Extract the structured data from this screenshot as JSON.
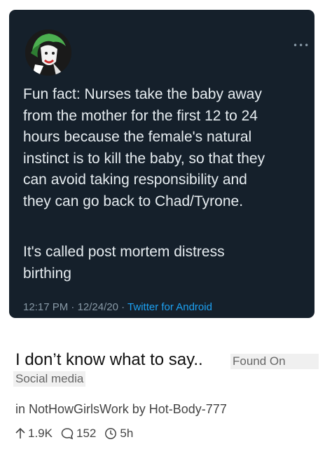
{
  "tweet": {
    "text_part1": "Fun fact: Nurses take the baby away\nfrom the mother for the first 12 to 24\nhours because the female's natural\ninstinct is to kill the baby, so that they\ncan avoid taking responsibility and\nthey can go back to Chad/Tyrone.",
    "text_part2": "It's called post mortem distress\nbirthing",
    "time": "12:17 PM",
    "date": "12/24/20",
    "separator": "·",
    "source": "Twitter for Android",
    "more_icon": "more-dots-icon",
    "avatar_icon": "joker-avatar"
  },
  "post": {
    "title": "I don’t know what to say..",
    "flair_part1": "Found On",
    "flair_part2": "Social media",
    "in_label": "in",
    "subreddit": "NotHowGirlsWork",
    "by_label": "by",
    "author": "Hot-Body-777",
    "upvotes": "1.9K",
    "comments": "152",
    "age": "5h"
  },
  "colors": {
    "card_bg": "#15202b",
    "tweet_text": "#e6ecf0",
    "meta_gray": "#8899a6",
    "link_blue": "#1da1f2"
  }
}
